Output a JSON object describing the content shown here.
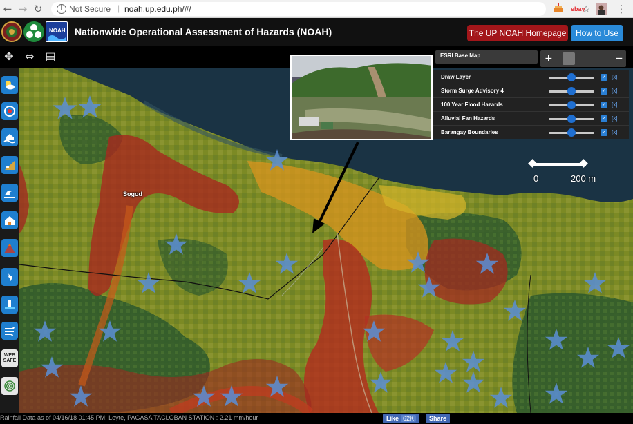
{
  "browser": {
    "security_label": "Not Secure",
    "url": "noah.up.edu.ph/#/",
    "ext_ebay_label": "ebay"
  },
  "header": {
    "title": "Nationwide Operational Assessment of Hazards (NOAH)",
    "homepage_button": "The UP NOAH Homepage",
    "howto_button": "How to Use",
    "logo_text": "NOAH"
  },
  "basemap": {
    "label": "ESRI Base Map",
    "plus": "+",
    "minus": "−"
  },
  "layers": [
    {
      "name": "Draw Layer",
      "opacity": 0.5,
      "checked": true,
      "remove": "[x]"
    },
    {
      "name": "Storm Surge Advisory 4",
      "opacity": 0.5,
      "checked": true,
      "remove": "[x]"
    },
    {
      "name": "100 Year Flood Hazards",
      "opacity": 0.5,
      "checked": true,
      "remove": "[x]"
    },
    {
      "name": "Alluvial Fan Hazards",
      "opacity": 0.5,
      "checked": true,
      "remove": "[x]"
    },
    {
      "name": "Barangay Boundaries",
      "opacity": 0.5,
      "checked": true,
      "remove": "[x]"
    }
  ],
  "map": {
    "place_label": "Sogod",
    "scale_start": "0",
    "scale_end": "200 m"
  },
  "status": {
    "rainfall_text": "Rainfall Data as of 04/16/18 01:45 PM:  Leyte, PAGASA TACLOBAN STATION : 2.21 mm/hour",
    "like_label": "Like",
    "like_count": "62K",
    "share_label": "Share"
  },
  "sidebar": {
    "items": [
      "weather-icon",
      "typhoon-icon",
      "flood-icon",
      "landslide-icon",
      "storm-surge-icon",
      "shelter-icon",
      "volcano-icon",
      "map-icon",
      "tide-icon",
      "wind-icon",
      "websafe-icon",
      "fingerprint-icon"
    ],
    "websafe_label": "WEB SAFE"
  },
  "colors": {
    "accent_blue": "#1f7fcf",
    "homepage_red": "#a3161a",
    "howto_blue": "#2a8ad8"
  }
}
